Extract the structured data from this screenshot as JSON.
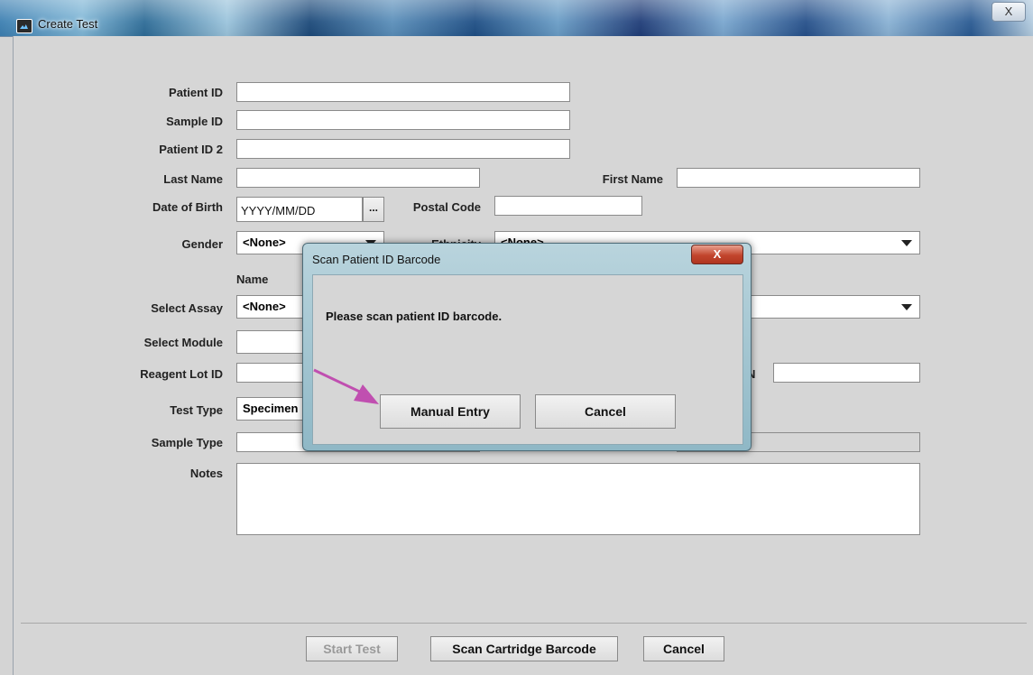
{
  "window": {
    "title": "Create Test",
    "close_label": "X"
  },
  "form": {
    "patient_id_label": "Patient ID",
    "sample_id_label": "Sample ID",
    "patient_id2_label": "Patient ID 2",
    "last_name_label": "Last Name",
    "first_name_label": "First Name",
    "dob_label": "Date of Birth",
    "dob_placeholder": "YYYY/MM/DD",
    "dob_picker_label": "...",
    "postal_code_label": "Postal Code",
    "gender_label": "Gender",
    "gender_value": "<None>",
    "ethnicity_label": "Ethnicity",
    "ethnicity_value": "<None>",
    "name_header": "Name",
    "select_assay_label": "Select Assay",
    "select_assay_value": "<None>",
    "select_module_label": "Select Module",
    "reagent_lot_label": "Reagent Lot ID",
    "sn_label_tail": "N",
    "test_type_label": "Test Type",
    "test_type_value": "Specimen",
    "sample_type_label": "Sample Type",
    "notes_label": "Notes"
  },
  "dialog": {
    "title": "Scan Patient ID Barcode",
    "close_label": "X",
    "message": "Please scan patient ID barcode.",
    "manual_entry_label": "Manual Entry",
    "cancel_label": "Cancel"
  },
  "footer": {
    "start_test_label": "Start Test",
    "scan_cartridge_label": "Scan Cartridge Barcode",
    "cancel_label": "Cancel"
  },
  "colors": {
    "annotation_arrow": "#c04fb0",
    "dialog_close": "#c2452d"
  }
}
